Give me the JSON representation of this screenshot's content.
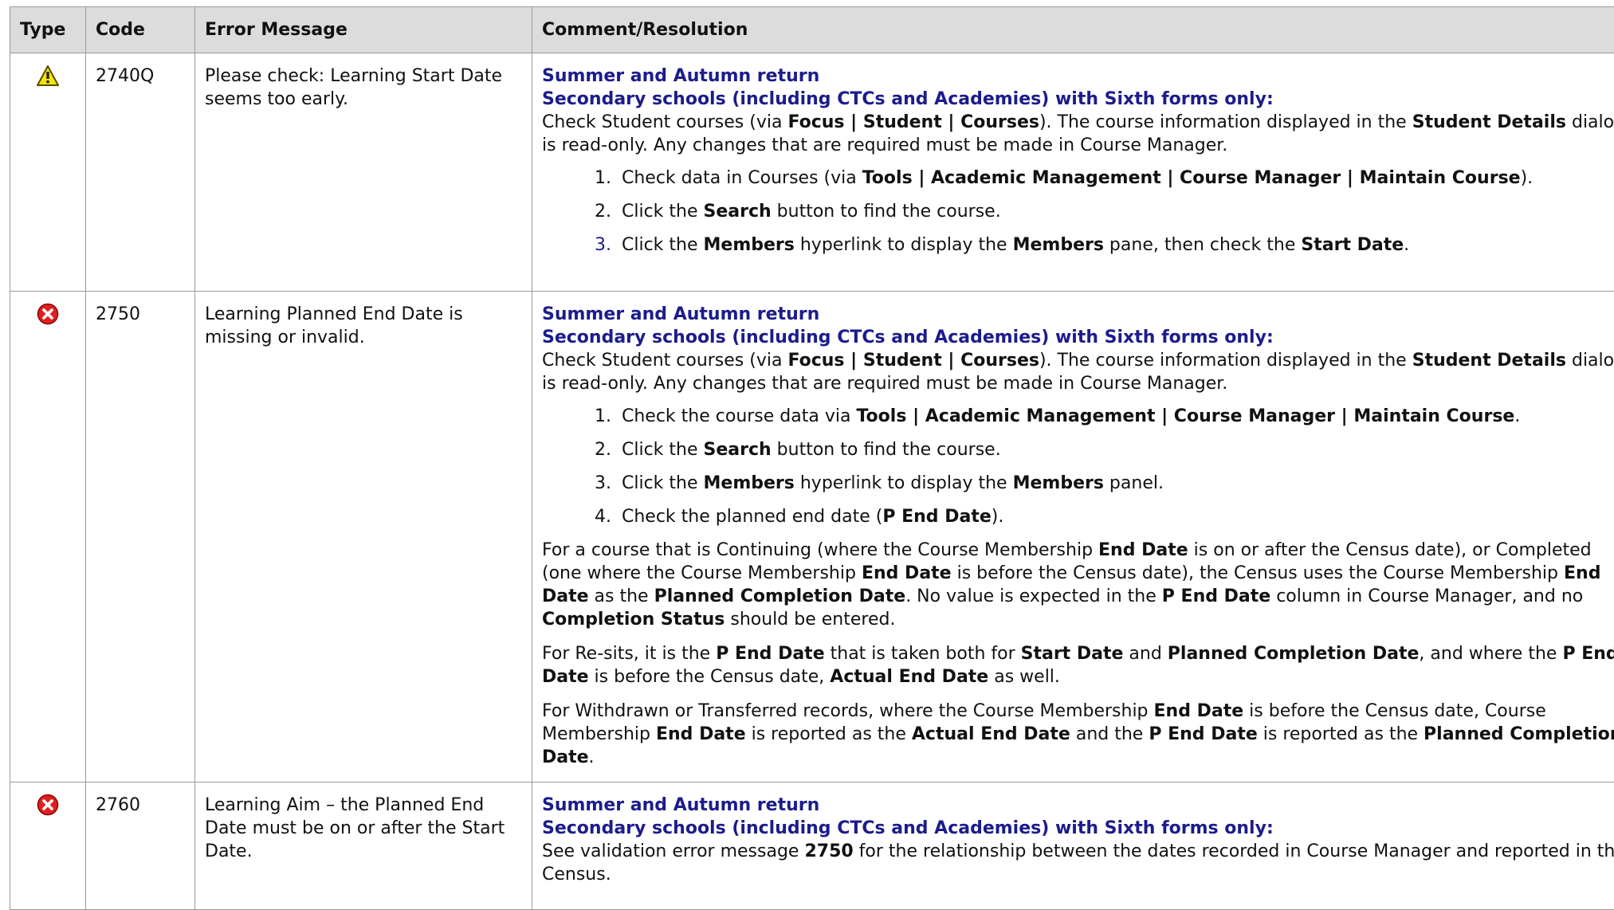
{
  "headers": {
    "type": "Type",
    "code": "Code",
    "message": "Error Message",
    "resolution": "Comment/Resolution"
  },
  "common": {
    "heading1": "Summer and Autumn return",
    "heading2": "Secondary schools (including CTCs and Academies) with Sixth forms only:"
  },
  "rows": [
    {
      "icon": "warning-icon",
      "code": "2740Q",
      "message": "Please check: Learning Start Date seems too early.",
      "intro": {
        "a": "Check Student courses (via ",
        "b": "Focus | Student | Courses",
        "c": "). The course information displayed in the ",
        "d": "Student Details",
        "e": " dialog is read-only. Any changes that are required must be made in Course Manager."
      },
      "steps": [
        {
          "a": "Check data in Courses (via ",
          "b": "Tools | Academic Management | Course Manager | Maintain Course",
          "c": ")."
        },
        {
          "a": "Click the ",
          "b": "Search",
          "c": " button to find the course."
        },
        {
          "a": "Click the ",
          "b": "Members",
          "c": " hyperlink to display the ",
          "d": "Members",
          "e": " pane, then check the ",
          "f": "Start Date",
          "g": "."
        }
      ]
    },
    {
      "icon": "error-icon",
      "code": "2750",
      "message": "Learning Planned End Date is missing or invalid.",
      "intro": {
        "a": "Check Student courses (via ",
        "b": "Focus | Student | Courses",
        "c": "). The course information displayed in the ",
        "d": "Student Details",
        "e": " dialog is read-only. Any changes that are required must be made in Course Manager."
      },
      "steps": [
        {
          "a": "Check the course data via ",
          "b": "Tools | Academic Management | Course Manager | Maintain Course",
          "c": "."
        },
        {
          "a": "Click the ",
          "b": "Search",
          "c": " button to find the course."
        },
        {
          "a": "Click the ",
          "b": "Members",
          "c": " hyperlink to display the ",
          "d": "Members",
          "e": " panel."
        },
        {
          "a": "Check the planned end date (",
          "b": "P End Date",
          "c": ")."
        }
      ],
      "para1": {
        "a": "For a course that is Continuing (where the Course Membership ",
        "b": "End Date",
        "c": " is on or after the Census date), or Completed (one where the Course Membership ",
        "d": "End Date",
        "e": " is before the Census date), the Census uses the Course Membership ",
        "f": "End Date",
        "g": " as the ",
        "h": "Planned Completion Date",
        "i": ". No value is expected in the ",
        "j": "P End Date",
        "k": " column in Course Manager, and no ",
        "l": "Completion Status",
        "m": " should be entered."
      },
      "para2": {
        "a": "For Re-sits, it is the ",
        "b": "P End Date",
        "c": " that is taken both for ",
        "d": "Start Date",
        "e": " and ",
        "f": "Planned Completion Date",
        "g": ", and where the ",
        "h": "P End Date",
        "i": " is before the Census date, ",
        "j": "Actual End Date",
        "k": " as well."
      },
      "para3": {
        "a": "For Withdrawn or Transferred records, where the Course Membership ",
        "b": "End Date",
        "c": " is before the Census date, Course Membership ",
        "d": "End Date",
        "e": " is reported as the ",
        "f": "Actual End Date",
        "g": " and the ",
        "h": "P End Date",
        "i": " is reported as the ",
        "j": "Planned Completion Date",
        "k": "."
      }
    },
    {
      "icon": "error-icon",
      "code": "2760",
      "message": "Learning Aim – the Planned End Date must be on or after the Start Date.",
      "intro": {
        "a": "See validation error message ",
        "b": "2750",
        "c": " for the relationship between the dates recorded in Course Manager and reported in the Census."
      }
    }
  ]
}
